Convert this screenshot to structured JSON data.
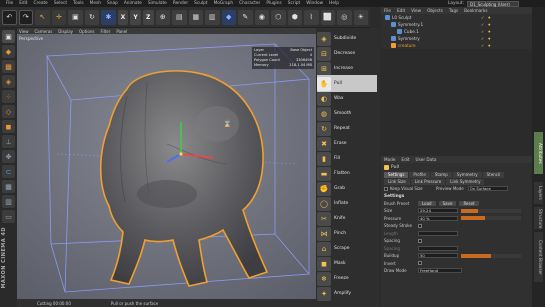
{
  "app": {
    "menu": [
      "File",
      "Edit",
      "Create",
      "Select",
      "Tools",
      "Mesh",
      "Snap",
      "Animate",
      "Simulate",
      "Render",
      "Sculpt",
      "MoGraph",
      "Character",
      "Plugins",
      "Script",
      "Window",
      "Help"
    ],
    "layout_label": "Layout:",
    "layout_value": "D1_Sculpting (User)"
  },
  "toolbar": {
    "axes": [
      "X",
      "Y",
      "Z"
    ]
  },
  "viewport": {
    "menu": [
      "View",
      "Cameras",
      "Display",
      "Options",
      "Filter",
      "Panel"
    ],
    "label": "Perspective",
    "info": [
      {
        "k": "Layer",
        "v": "Base Object"
      },
      {
        "k": "Current Level",
        "v": "4"
      },
      {
        "k": "Polygon Count",
        "v": "3306496"
      },
      {
        "k": "Memory",
        "v": "218.1.04 MB"
      }
    ]
  },
  "status": {
    "time": "Cutting 00:00:00",
    "message": "Pull or push the surface"
  },
  "brand": "MAXON CINEMA 4D",
  "tools": [
    "Subdivide",
    "Decrease",
    "Increase",
    "Pull",
    "Wax",
    "Smooth",
    "Repeat",
    "Erase",
    "Fill",
    "Flatten",
    "Grab",
    "Inflate",
    "Knife",
    "Pinch",
    "Scrape",
    "Mask",
    "Freeze",
    "Amplify"
  ],
  "active_tool": "Pull",
  "object_manager": {
    "menu": [
      "File",
      "Edit",
      "View",
      "Objects",
      "Tags",
      "Bookmarks"
    ],
    "objects": [
      {
        "name": "L0 Sculpt",
        "depth": 0,
        "highlight": false
      },
      {
        "name": "Symmetry.1",
        "depth": 1,
        "highlight": false
      },
      {
        "name": "Cube.1",
        "depth": 2,
        "highlight": false
      },
      {
        "name": "Symmetry",
        "depth": 1,
        "highlight": false
      },
      {
        "name": "creature",
        "depth": 1,
        "highlight": true
      },
      {
        "name": "Floor",
        "depth": 2,
        "highlight": false
      }
    ]
  },
  "attributes": {
    "menu": [
      "Mode",
      "Edit",
      "User Data"
    ],
    "title": "Pull",
    "tabs": [
      "Settings",
      "Profile",
      "Stamp",
      "Symmetry",
      "Stencil"
    ],
    "tabs2": [
      "Link Size",
      "Link Pressure",
      "Link Symmetry"
    ],
    "keep_visual_size": "Keep Visual Size",
    "preview_mode": "Preview Mode",
    "preview_value": "On Surface",
    "section": "Settings",
    "brush_preset_label": "Brush Preset",
    "presets": [
      "Load",
      "Save",
      "Reset"
    ],
    "size_label": "Size",
    "size_value": "29.24",
    "size_fraction": 0.29,
    "pressure_label": "Pressure",
    "pressure_value": "40 %",
    "pressure_fraction": 0.4,
    "steady_label": "Steady Stroke",
    "length_label": "Length",
    "spacing_label": "Spacing",
    "spacing2_label": "Spacing",
    "buildup_label": "Buildup",
    "buildup_value": "50",
    "invert_label": "Invert",
    "draw_mode_label": "Draw Mode",
    "draw_mode_value": "FreeHand"
  },
  "vtabs": [
    "Attributes",
    "Layers",
    "Structure",
    "Content Browser"
  ]
}
